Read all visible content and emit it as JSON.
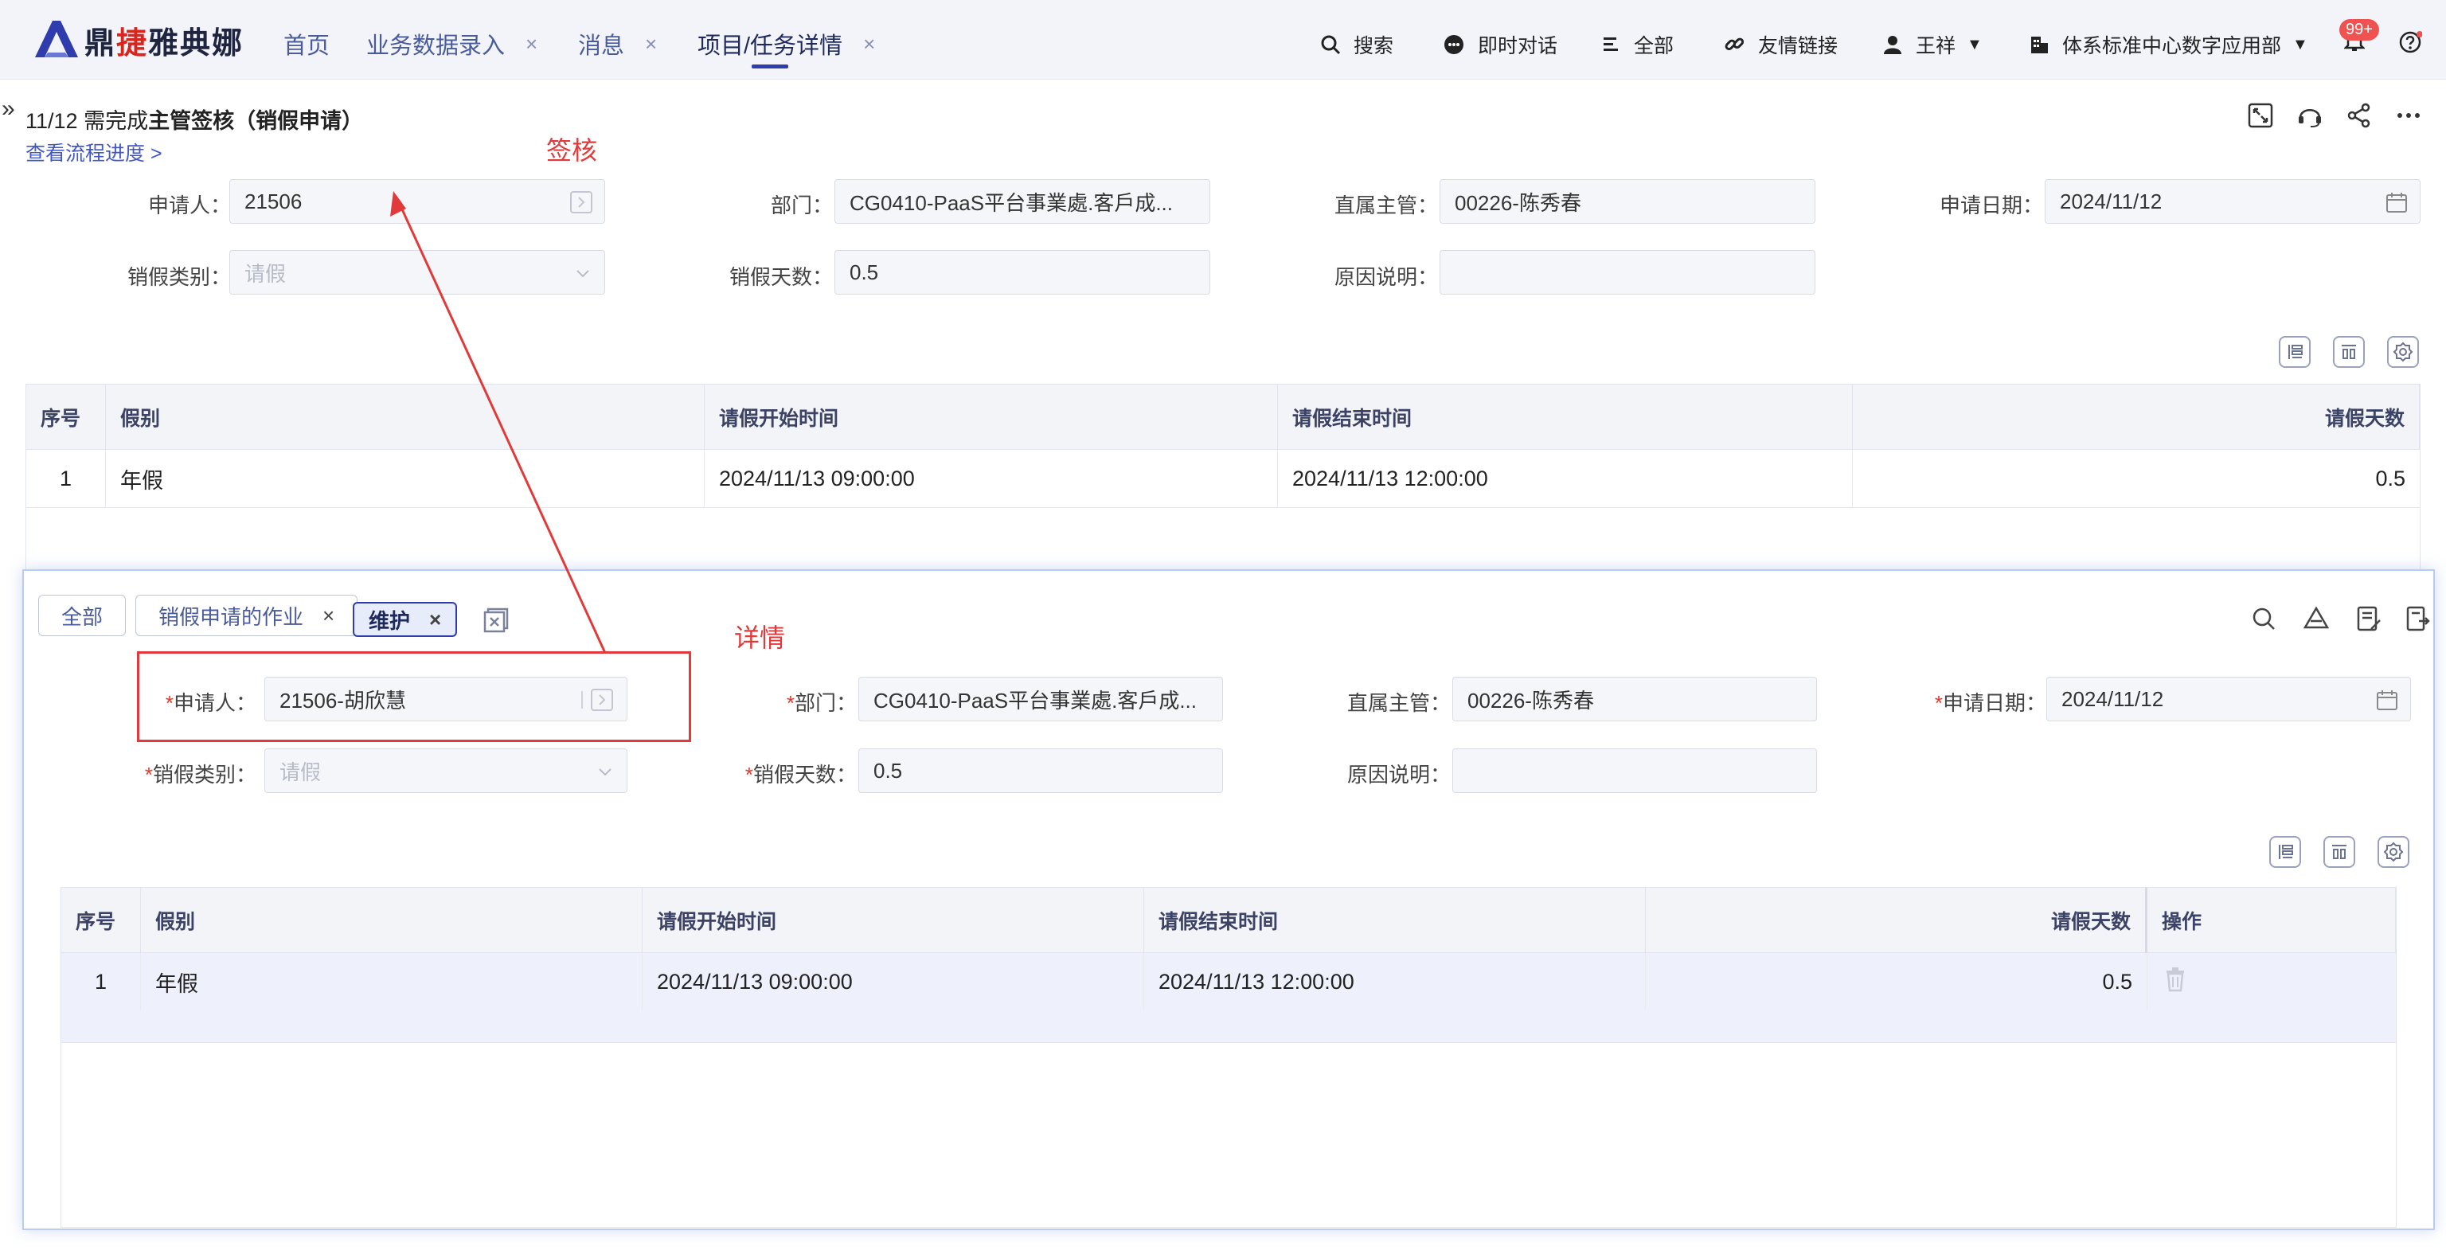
{
  "nav": {
    "brand": {
      "part1": "鼎",
      "part2": "捷",
      "part3": "雅典娜"
    },
    "tabs": [
      {
        "label": "首页",
        "closable": false
      },
      {
        "label": "业务数据录入",
        "closable": true,
        "close": "×"
      },
      {
        "label": "消息",
        "closable": true,
        "close": "×"
      },
      {
        "label": "项目/任务详情",
        "closable": true,
        "close": "×",
        "active": true
      }
    ],
    "tools": {
      "search": "搜索",
      "chat": "即时对话",
      "all": "全部",
      "links": "友情链接",
      "user": "王祥",
      "org": "体系标准中心数字应用部"
    },
    "badge": "99+",
    "accent": "#2e3cae"
  },
  "header": {
    "expand": "»",
    "title_prefix": "11/12 需完成",
    "title_bold": "主管签核（销假申请）",
    "flow_link": "查看流程进度 >",
    "annotation_sign": "签核",
    "annotation_detail": "详情"
  },
  "form_top": {
    "applicant_label": "申请人：",
    "applicant_value": "21506",
    "dept_label": "部门：",
    "dept_value": "CG0410-PaaS平台事業處.客戶成...",
    "manager_label": "直属主管：",
    "manager_value": "00226-陈秀春",
    "date_label": "申请日期：",
    "date_value": "2024/11/12",
    "type_label": "销假类别：",
    "type_placeholder": "请假",
    "days_label": "销假天数：",
    "days_value": "0.5",
    "reason_label": "原因说明：",
    "reason_value": ""
  },
  "table_top": {
    "headers": [
      "序号",
      "假别",
      "请假开始时间",
      "请假结束时间",
      "请假天数"
    ],
    "rows": [
      [
        "1",
        "年假",
        "2024/11/13 09:00:00",
        "2024/11/13 12:00:00",
        "0.5"
      ]
    ]
  },
  "panel": {
    "chips": [
      {
        "label": "全部",
        "closable": false
      },
      {
        "label": "销假申请的作业",
        "closable": true,
        "close": "×"
      },
      {
        "label": "维护",
        "closable": true,
        "close": "×",
        "active": true
      }
    ],
    "form": {
      "req": "*",
      "applicant_label": "申请人：",
      "applicant_value": "21506-胡欣慧",
      "dept_label": "部门：",
      "dept_value": "CG0410-PaaS平台事業處.客戶成...",
      "manager_label": "直属主管：",
      "manager_value": "00226-陈秀春",
      "date_label": "申请日期：",
      "date_value": "2024/11/12",
      "type_label": "销假类别：",
      "type_placeholder": "请假",
      "days_label": "销假天数：",
      "days_value": "0.5",
      "reason_label": "原因说明：",
      "reason_value": ""
    },
    "table": {
      "headers": [
        "序号",
        "假别",
        "请假开始时间",
        "请假结束时间",
        "请假天数",
        "操作"
      ],
      "rows": [
        [
          "1",
          "年假",
          "2024/11/13 09:00:00",
          "2024/11/13 12:00:00",
          "0.5"
        ]
      ]
    }
  },
  "colors": {
    "annotation": "#e03a3a",
    "link": "#4157c8",
    "panel_border": "#b9cdf3"
  }
}
